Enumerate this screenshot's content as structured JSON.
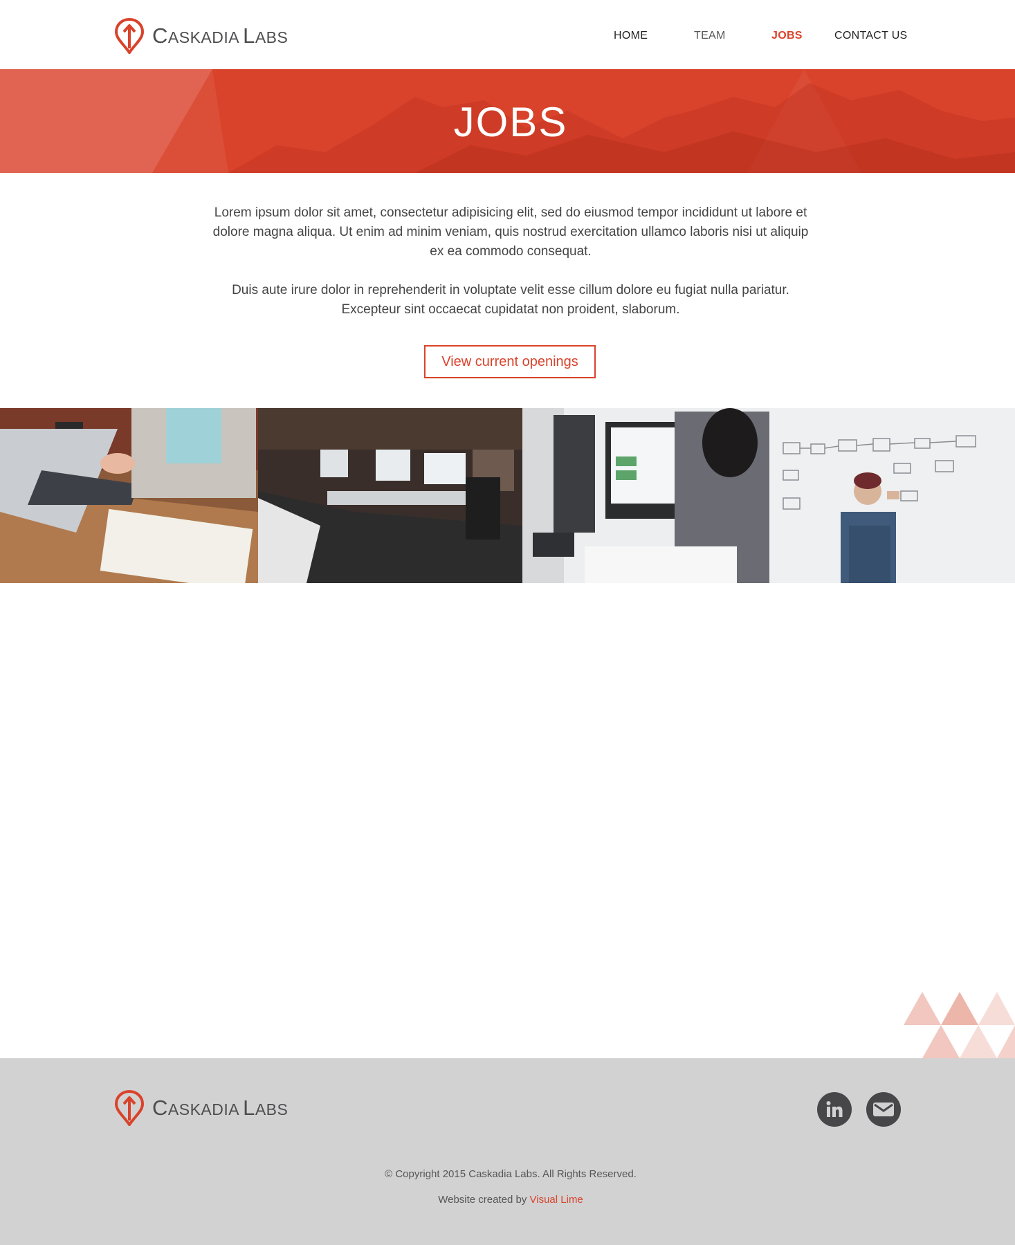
{
  "brand": {
    "name_first_initial": "C",
    "name_first_rest": "ASKADIA",
    "name_second_initial": "L",
    "name_second_rest": "ABS",
    "logo_icon": "map-pin-arrow-icon",
    "accent_color": "#d9432b"
  },
  "nav": {
    "items": [
      {
        "label": "HOME",
        "active": false
      },
      {
        "label": "TEAM",
        "active": false
      },
      {
        "label": "JOBS",
        "active": true
      },
      {
        "label": "CONTACT US",
        "active": false
      }
    ]
  },
  "hero": {
    "title": "JOBS"
  },
  "intro": {
    "paragraph_1": "Lorem ipsum dolor sit amet, consectetur adipisicing elit, sed do eiusmod tempor incididunt ut labore et dolore magna aliqua. Ut enim ad minim veniam, quis nostrud exercitation ullamco laboris nisi ut aliquip ex ea commodo consequat.",
    "paragraph_2": "Duis aute irure dolor in reprehenderit in voluptate velit esse cillum dolore eu fugiat nulla pariatur. Excepteur sint occaecat cupidatat non proident, slaborum.",
    "cta_label": "View current openings"
  },
  "photos": [
    {
      "subject": "laptop-desk-photo"
    },
    {
      "subject": "open-office-photo"
    },
    {
      "subject": "monitor-workstation-photo"
    },
    {
      "subject": "whiteboard-flowchart-photo"
    }
  ],
  "footer": {
    "social_icons": [
      "linkedin-icon",
      "mail-icon"
    ],
    "copyright": "© Copyright 2015 Caskadia Labs. All Rights Reserved.",
    "credit_prefix": "Website created by ",
    "credit_link": "Visual Lime",
    "background_color": "#d2d2d3"
  }
}
